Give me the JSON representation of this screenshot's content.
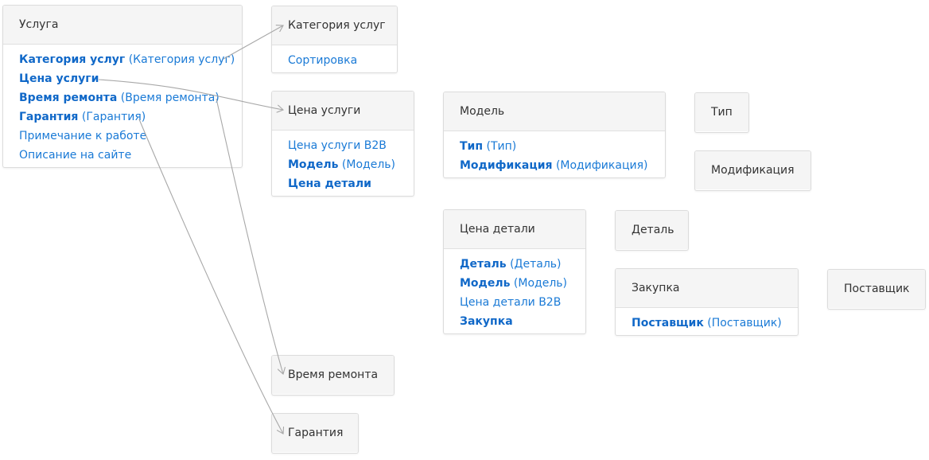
{
  "entities": {
    "usluga": {
      "title": "Услуга",
      "fields": [
        {
          "name": "Категория услуг",
          "target": "(Категория услуг)"
        },
        {
          "name": "Цена услуги",
          "target": ""
        },
        {
          "name": "Время ремонта",
          "target": "(Время ремонта)"
        },
        {
          "name": "Гарантия",
          "target": "(Гарантия)"
        },
        {
          "name": "Примечание к работе",
          "target": ""
        },
        {
          "name": "Описание на сайте",
          "target": ""
        }
      ]
    },
    "kategoriya": {
      "title": "Категория услуг",
      "fields": [
        {
          "name": "Сортировка",
          "target": ""
        }
      ]
    },
    "cena_uslugi": {
      "title": "Цена услуги",
      "fields": [
        {
          "name": "Цена услуги B2B",
          "target": ""
        },
        {
          "name": "Модель",
          "target": "(Модель)"
        },
        {
          "name": "Цена детали",
          "target": ""
        }
      ]
    },
    "model": {
      "title": "Модель",
      "fields": [
        {
          "name": "Тип",
          "target": "(Тип)"
        },
        {
          "name": "Модификация",
          "target": "(Модификация)"
        }
      ]
    },
    "tip": {
      "title": "Тип"
    },
    "modifikaciya": {
      "title": "Модификация"
    },
    "cena_detali": {
      "title": "Цена детали",
      "fields": [
        {
          "name": "Деталь",
          "target": "(Деталь)"
        },
        {
          "name": "Модель",
          "target": "(Модель)"
        },
        {
          "name": "Цена детали B2B",
          "target": ""
        },
        {
          "name": "Закупка",
          "target": ""
        }
      ]
    },
    "detal": {
      "title": "Деталь"
    },
    "zakupka": {
      "title": "Закупка",
      "fields": [
        {
          "name": "Поставщик",
          "target": "(Поставщик)"
        }
      ]
    },
    "postavshchik": {
      "title": "Поставщик"
    },
    "vremya": {
      "title": "Время ремонта"
    },
    "garantiya": {
      "title": "Гарантия"
    }
  },
  "colors": {
    "link_blue": "#1a7ad6",
    "header_bg": "#f5f5f5",
    "border": "#dcdcdc",
    "connector": "#a8a8a8"
  }
}
